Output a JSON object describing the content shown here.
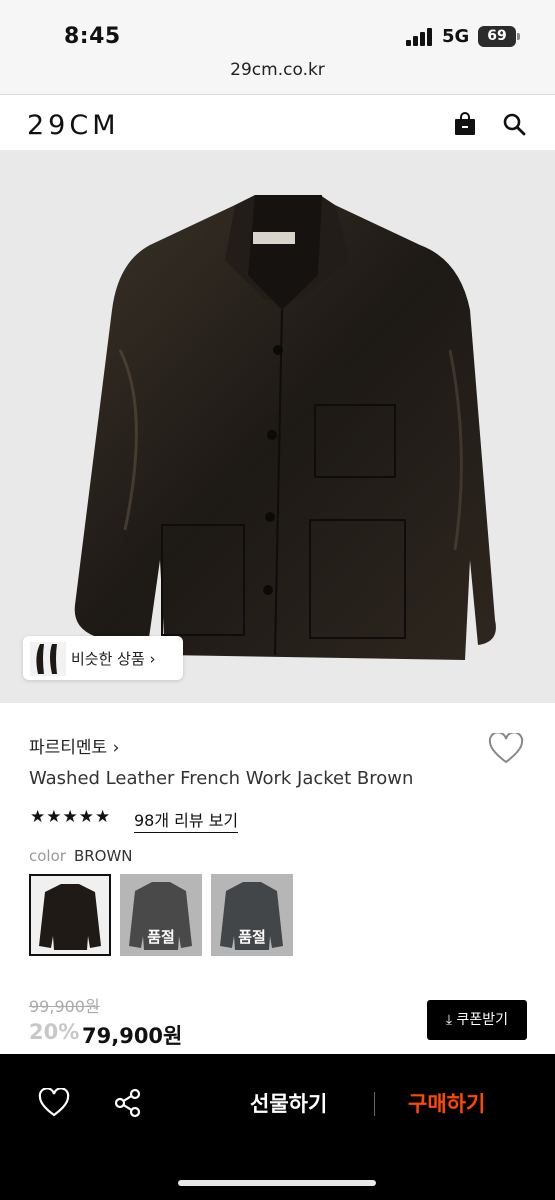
{
  "status_bar": {
    "time": "8:45",
    "network": "5G",
    "battery": "69"
  },
  "browser": {
    "url": "29cm.co.kr"
  },
  "header": {
    "logo": "29CM",
    "icons": [
      "shopping-bag-icon",
      "search-icon"
    ]
  },
  "similar_products": {
    "label": "비슷한 상품 ›"
  },
  "product": {
    "brand": "파르티멘토 ›",
    "title": "Washed Leather French Work Jacket Brown",
    "stars": "★★★★★",
    "rating": 5,
    "reviews_link": "98개 리뷰 보기",
    "color_label": "color",
    "color_value": "BROWN",
    "swatches": [
      {
        "selected": true,
        "sold_out_label": ""
      },
      {
        "selected": false,
        "sold_out_label": "품절"
      },
      {
        "selected": false,
        "sold_out_label": "품절"
      }
    ],
    "original_price": "99,900원",
    "discount": "20%",
    "price": "79,900원",
    "coupon_button": "⤓ 쿠폰받기"
  },
  "bottom_bar": {
    "gift_button": "선물하기",
    "buy_button": "구매하기",
    "buy_color": "#ff4800"
  }
}
